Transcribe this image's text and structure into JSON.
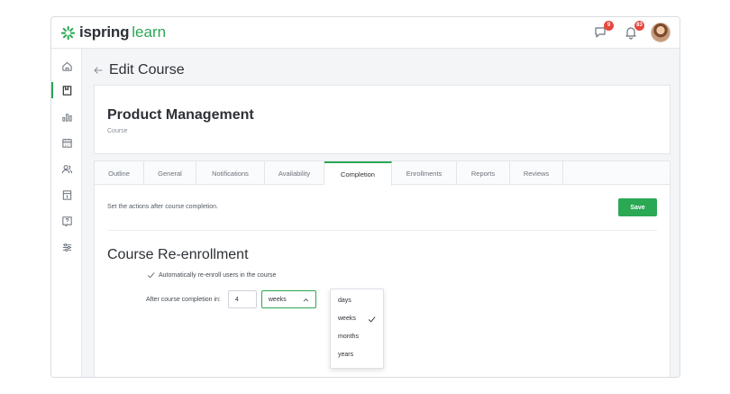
{
  "app": {
    "logo_part1": "ispring",
    "logo_part2": "learn",
    "brand_color": "#2aa854"
  },
  "header": {
    "notifications_badge": "9",
    "alerts_badge": "83"
  },
  "sidebar": {
    "items": [
      {
        "icon": "home-icon"
      },
      {
        "icon": "book-icon",
        "active": true
      },
      {
        "icon": "chart-icon"
      },
      {
        "icon": "calendar-icon"
      },
      {
        "icon": "users-icon"
      },
      {
        "icon": "calendar-day-icon"
      },
      {
        "icon": "help-icon"
      },
      {
        "icon": "settings-sliders-icon"
      }
    ]
  },
  "page": {
    "title": "Edit Course"
  },
  "course": {
    "name": "Product Management",
    "type": "Course"
  },
  "tabs": [
    {
      "label": "Outline"
    },
    {
      "label": "General"
    },
    {
      "label": "Notifications"
    },
    {
      "label": "Availability"
    },
    {
      "label": "Completion",
      "active": true
    },
    {
      "label": "Enrollments"
    },
    {
      "label": "Reports"
    },
    {
      "label": "Reviews"
    }
  ],
  "completion": {
    "hint": "Set the actions after course completion.",
    "save_label": "Save",
    "section_title": "Course Re-enrollment",
    "auto_reenroll_label": "Automatically re-enroll users in the course",
    "auto_reenroll_checked": true,
    "after_label": "After course completion in:",
    "interval_value": "4",
    "unit_selected": "weeks",
    "unit_options": [
      "days",
      "weeks",
      "months",
      "years"
    ]
  }
}
